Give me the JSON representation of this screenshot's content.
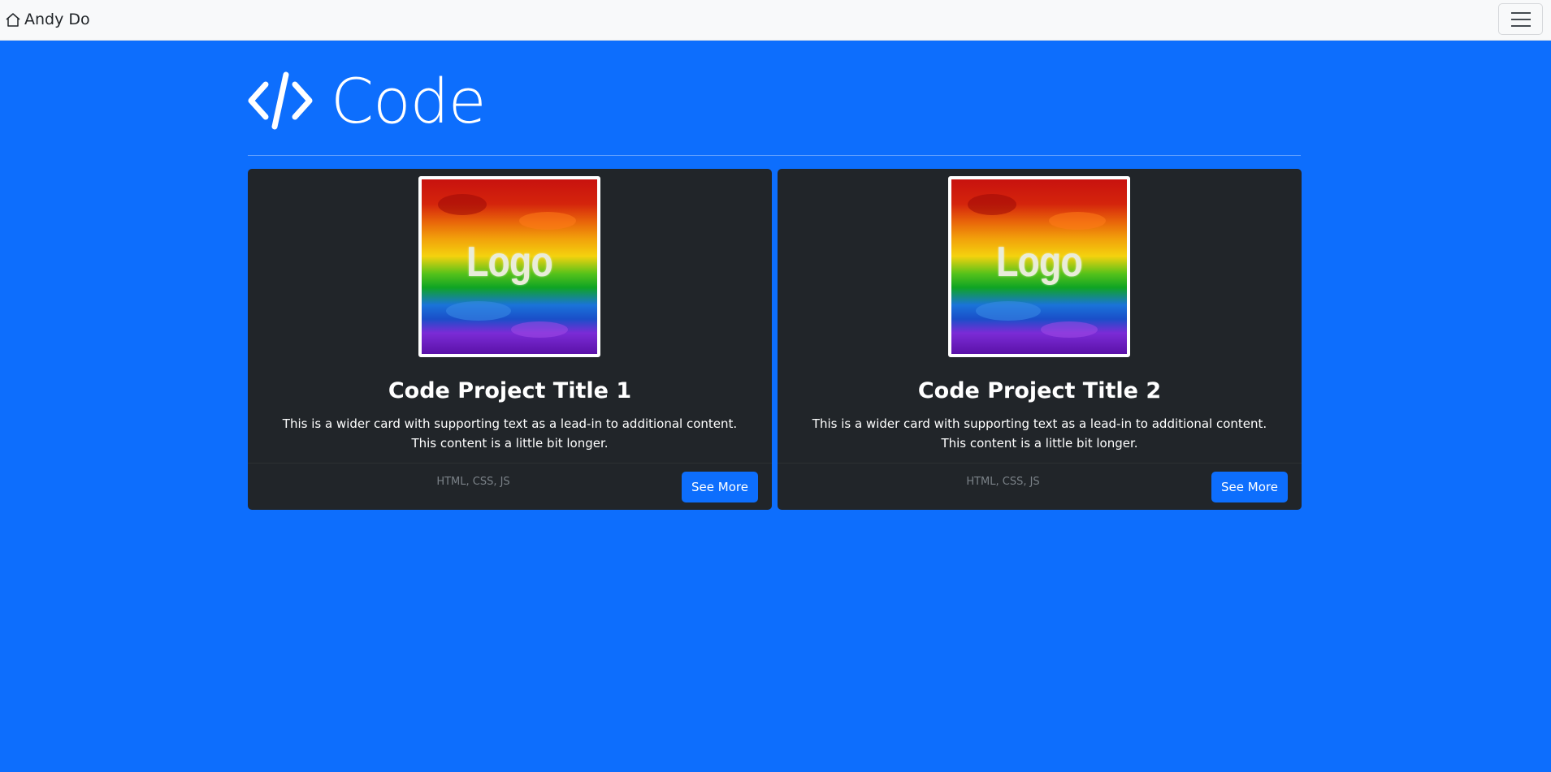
{
  "navbar": {
    "brand_label": "Andy Do",
    "brand_icon": "house-icon",
    "toggler_icon": "hamburger-menu-icon"
  },
  "page": {
    "title": "Code",
    "title_icon": "code-slash-icon",
    "background_color": "#0d6efd"
  },
  "cards": [
    {
      "logo_text": "Logo",
      "title": "Code Project Title 1",
      "text": "This is a wider card with supporting text as a lead-in to additional content. This content is a little bit longer.",
      "tech": "HTML, CSS, JS",
      "button_label": "See More"
    },
    {
      "logo_text": "Logo",
      "title": "Code Project Title 2",
      "text": "This is a wider card with supporting text as a lead-in to additional content. This content is a little bit longer.",
      "tech": "HTML, CSS, JS",
      "button_label": "See More"
    }
  ],
  "colors": {
    "card_bg": "#212529",
    "button_bg": "#0d6efd",
    "navbar_bg": "#f8f9fa"
  }
}
